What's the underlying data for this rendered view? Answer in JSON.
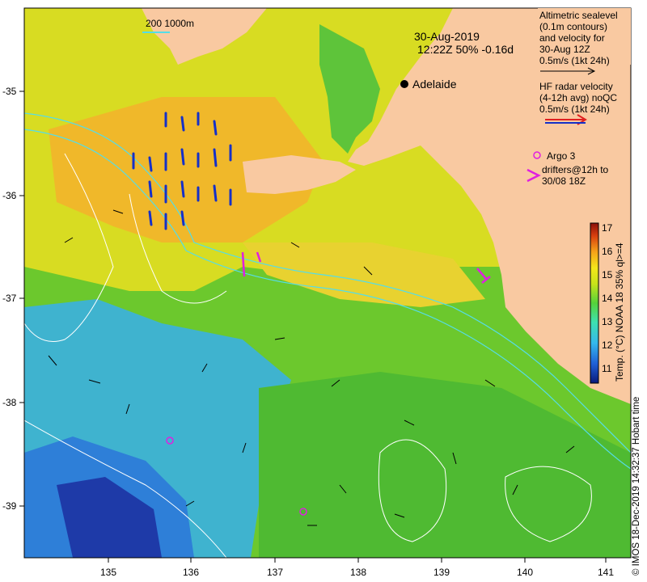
{
  "map": {
    "scale_bar_label": "200  1000m",
    "date": "30-Aug-2019",
    "time_stats": "12:22Z  50% -0.16d",
    "city_name": "Adelaide",
    "sea_level_legend": [
      "Altimetric sealevel",
      "(0.1m contours)",
      "and velocity for",
      "30-Aug 12Z",
      "0.5m/s (1kt 24h)"
    ],
    "hf_radar_legend": [
      "HF radar velocity",
      "(4-12h avg) noQC",
      "0.5m/s (1kt 24h)"
    ],
    "argo_legend": "Argo 3",
    "drifter_legend": [
      "drifters@12h to",
      "30/08 18Z"
    ],
    "colorbar_title": "Temp. (°C) NOAA 18 35% ql>=4",
    "colorbar_ticks": [
      "17",
      "16",
      "15",
      "14",
      "13",
      "12",
      "11"
    ],
    "lon_ticks": [
      "135",
      "136",
      "137",
      "138",
      "139",
      "140",
      "141"
    ],
    "lat_ticks": [
      "-35",
      "-36",
      "-37",
      "-38",
      "-39"
    ],
    "credit": "© IMOS 18-Dec-2019 14:32:37 Hobart time",
    "colors": {
      "land": "#F9C9A1",
      "hf_radar": "#1530c8",
      "argo": "#e020e0",
      "contour": "#ffffff",
      "isobath": "#55dde8"
    }
  }
}
